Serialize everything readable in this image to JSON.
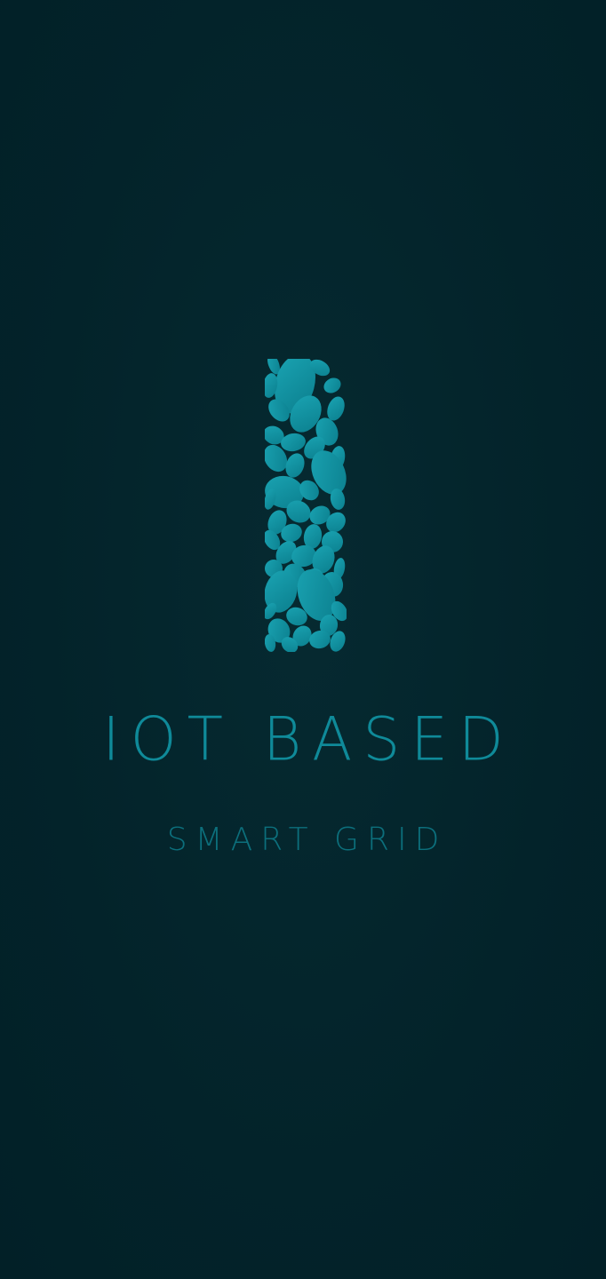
{
  "splash": {
    "title": "IOT BASED",
    "subtitle": "SMART GRID",
    "logo_icon": "leaf-mosaic-i-icon",
    "background_color": "#03232A",
    "accent_color": "#0F8A99",
    "subtitle_color": "#0C6F7C"
  }
}
